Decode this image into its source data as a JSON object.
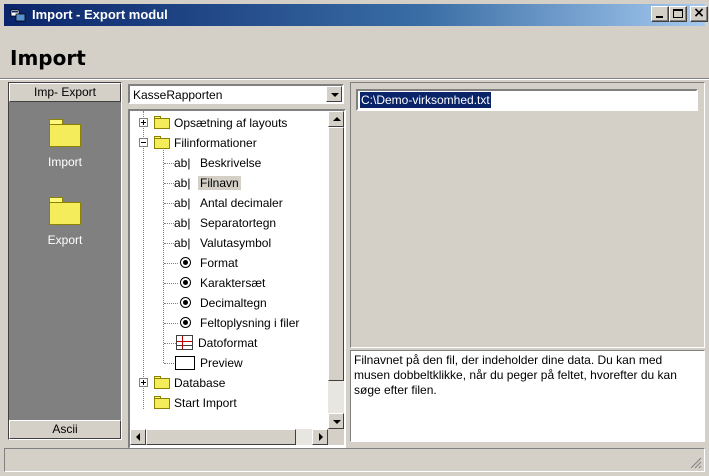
{
  "window": {
    "title": "Import - Export modul",
    "module_title": "Import",
    "colors": {
      "titlebar_start": "#0a246a",
      "titlebar_end": "#a6caf0",
      "face": "#d4d0c8",
      "outlook_bg": "#808080",
      "selection": "#0a246a"
    }
  },
  "outlook_bar": {
    "header": "Imp- Export",
    "items": [
      {
        "label": "Import",
        "icon": "folder-icon"
      },
      {
        "label": "Export",
        "icon": "folder-icon"
      }
    ],
    "footer": "Ascii"
  },
  "combo": {
    "selected": "KasseRapporten"
  },
  "tree": {
    "nodes": [
      {
        "label": "Opsætning af layouts",
        "icon": "folder-icon",
        "expander": "+"
      },
      {
        "label": "Filinformationer",
        "icon": "folder-icon",
        "expander": "-"
      },
      {
        "label": "Beskrivelse",
        "icon": "text-field-icon"
      },
      {
        "label": "Filnavn",
        "icon": "text-field-icon",
        "selected": true
      },
      {
        "label": "Antal decimaler",
        "icon": "text-field-icon"
      },
      {
        "label": "Separatortegn",
        "icon": "text-field-icon"
      },
      {
        "label": "Valutasymbol",
        "icon": "text-field-icon"
      },
      {
        "label": "Format",
        "icon": "radio-icon"
      },
      {
        "label": "Karaktersæt",
        "icon": "radio-icon"
      },
      {
        "label": "Decimaltegn",
        "icon": "radio-icon"
      },
      {
        "label": "Feltoplysning i filer",
        "icon": "radio-icon"
      },
      {
        "label": "Datoformat",
        "icon": "grid-icon"
      },
      {
        "label": "Preview",
        "icon": "preview-icon"
      },
      {
        "label": "Database",
        "icon": "folder-icon",
        "expander": "+"
      },
      {
        "label": "Start Import",
        "icon": "folder-icon"
      }
    ],
    "ab_glyph": "ab|"
  },
  "detail": {
    "file_path": "C:\\Demo-virksomhed.txt",
    "help_text": "Filnavnet på den fil, der indeholder dine data. Du kan med musen dobbeltklikke, når du peger på feltet, hvorefter du kan søge efter filen."
  }
}
